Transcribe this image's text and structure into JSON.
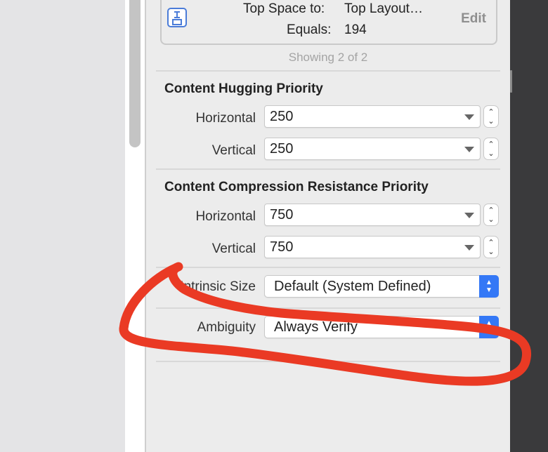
{
  "constraint": {
    "top_space_label": "Top Space to:",
    "top_space_value": "Top Layout…",
    "equals_label": "Equals:",
    "equals_value": "194",
    "edit_label": "Edit"
  },
  "showing_text": "Showing 2 of 2",
  "content_hugging": {
    "title": "Content Hugging Priority",
    "horizontal_label": "Horizontal",
    "horizontal_value": "250",
    "vertical_label": "Vertical",
    "vertical_value": "250"
  },
  "compression_resistance": {
    "title": "Content Compression Resistance Priority",
    "horizontal_label": "Horizontal",
    "horizontal_value": "750",
    "vertical_label": "Vertical",
    "vertical_value": "750"
  },
  "intrinsic_size": {
    "label": "Intrinsic Size",
    "value": "Default (System Defined)"
  },
  "ambiguity": {
    "label": "Ambiguity",
    "value": "Always Verify"
  },
  "colors": {
    "accent": "#3478f6",
    "annotation": "#ea3a24",
    "dark_panel": "#3a3a3c"
  },
  "icons": {
    "constraint": "vertical-spacing-constraint-icon",
    "popup_arrows": "up-down-chevron-icon",
    "stepper": "stepper-arrows-icon"
  }
}
